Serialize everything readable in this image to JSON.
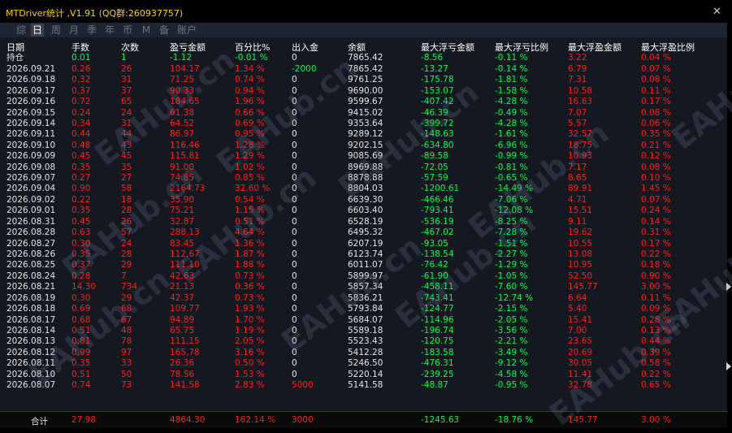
{
  "window": {
    "title": "MTDriver统计 ,V1.91 (QQ群:260937757)",
    "close_label": "✕"
  },
  "tabs": [
    "综",
    "日",
    "周",
    "月",
    "季",
    "年",
    "币",
    "M",
    "备",
    "账户"
  ],
  "active_tab": 1,
  "columns": [
    "日期",
    "手数",
    "次数",
    "盈亏金额",
    "百分比%",
    "出入金",
    "余额",
    "最大浮亏金额",
    "最大浮亏比例",
    "最大浮盈金额",
    "最大浮盈比例"
  ],
  "hold_row": [
    "持仓",
    "0.01",
    "1",
    "-1.12",
    "-0.01 %",
    "0",
    "7865.42",
    "-8.56",
    "-0.11 %",
    "3.22",
    "0.04 %"
  ],
  "rows": [
    [
      "2026.09.21",
      "0.26",
      "26",
      "104.17",
      "1.34 %",
      "-2000",
      "7865.42",
      "-13.27",
      "-0.14 %",
      "6.79",
      "0.07 %"
    ],
    [
      "2026.09.18",
      "0.32",
      "31",
      "71.25",
      "0.74 %",
      "0",
      "9761.25",
      "-175.78",
      "-1.81 %",
      "7.31",
      "0.08 %"
    ],
    [
      "2026.09.17",
      "0.37",
      "37",
      "90.33",
      "0.94 %",
      "0",
      "9690.00",
      "-153.07",
      "-1.58 %",
      "10.58",
      "0.11 %"
    ],
    [
      "2026.09.16",
      "0.72",
      "65",
      "184.65",
      "1.96 %",
      "0",
      "9599.67",
      "-407.42",
      "-4.28 %",
      "16.63",
      "0.17 %"
    ],
    [
      "2026.09.15",
      "0.24",
      "24",
      "61.38",
      "0.66 %",
      "0",
      "9415.02",
      "-46.39",
      "-0.49 %",
      "7.07",
      "0.08 %"
    ],
    [
      "2026.09.14",
      "0.34",
      "31",
      "64.52",
      "0.69 %",
      "0",
      "9353.64",
      "-399.72",
      "-4.28 %",
      "5.57",
      "0.06 %"
    ],
    [
      "2026.09.11",
      "0.44",
      "44",
      "86.97",
      "0.95 %",
      "0",
      "9289.12",
      "-148.63",
      "-1.61 %",
      "32.57",
      "0.35 %"
    ],
    [
      "2026.09.10",
      "0.48",
      "43",
      "116.46",
      "1.28 %",
      "0",
      "9202.15",
      "-634.80",
      "-6.96 %",
      "18.75",
      "0.21 %"
    ],
    [
      "2026.09.09",
      "0.45",
      "45",
      "115.81",
      "1.29 %",
      "0",
      "9085.69",
      "-89.58",
      "-0.99 %",
      "10.93",
      "0.12 %"
    ],
    [
      "2026.09.08",
      "0.35",
      "35",
      "91.00",
      "1.02 %",
      "0",
      "8969.88",
      "-72.05",
      "-0.81 %",
      "7.17",
      "0.08 %"
    ],
    [
      "2026.09.07",
      "0.27",
      "27",
      "74.85",
      "0.85 %",
      "0",
      "8878.88",
      "-57.59",
      "-0.65 %",
      "8.65",
      "0.10 %"
    ],
    [
      "2026.09.04",
      "0.90",
      "58",
      "2164.73",
      "32.60 %",
      "0",
      "8804.03",
      "-1200.61",
      "-14.49 %",
      "89.91",
      "1.45 %"
    ],
    [
      "2026.09.02",
      "0.22",
      "18",
      "35.90",
      "0.54 %",
      "0",
      "6639.30",
      "-466.46",
      "-7.06 %",
      "4.71",
      "0.07 %"
    ],
    [
      "2026.09.01",
      "0.35",
      "28",
      "75.21",
      "1.15 %",
      "0",
      "6603.40",
      "-793.41",
      "-12.08 %",
      "15.51",
      "0.24 %"
    ],
    [
      "2026.08.31",
      "0.45",
      "26",
      "32.87",
      "0.51 %",
      "0",
      "6528.19",
      "-536.19",
      "-8.25 %",
      "9.11",
      "0.14 %"
    ],
    [
      "2026.08.28",
      "0.63",
      "57",
      "288.13",
      "4.64 %",
      "0",
      "6495.32",
      "-467.02",
      "-7.28 %",
      "19.62",
      "0.31 %"
    ],
    [
      "2026.08.27",
      "0.30",
      "24",
      "83.45",
      "1.36 %",
      "0",
      "6207.19",
      "-93.05",
      "-1.51 %",
      "10.55",
      "0.17 %"
    ],
    [
      "2026.08.26",
      "0.35",
      "28",
      "112.67",
      "1.87 %",
      "0",
      "6123.74",
      "-138.54",
      "-2.27 %",
      "13.08",
      "0.22 %"
    ],
    [
      "2026.08.25",
      "0.37",
      "29",
      "111.10",
      "1.88 %",
      "0",
      "6011.07",
      "-76.42",
      "-1.29 %",
      "10.95",
      "0.18 %"
    ],
    [
      "2026.08.24",
      "0.28",
      "7",
      "42.63",
      "0.73 %",
      "0",
      "5899.97",
      "-61.90",
      "-1.05 %",
      "52.50",
      "0.90 %"
    ],
    [
      "2026.08.21",
      "14.30",
      "734",
      "21.13",
      "0.36 %",
      "0",
      "5857.34",
      "-458.11",
      "-7.60 %",
      "145.77",
      "3.00 %"
    ],
    [
      "2026.08.19",
      "0.30",
      "29",
      "42.37",
      "0.73 %",
      "0",
      "5836.21",
      "-743.41",
      "-12.74 %",
      "6.64",
      "0.11 %"
    ],
    [
      "2026.08.18",
      "0.69",
      "68",
      "109.77",
      "1.93 %",
      "0",
      "5793.84",
      "-124.77",
      "-2.15 %",
      "5.40",
      "0.09 %"
    ],
    [
      "2026.08.17",
      "0.68",
      "67",
      "94.89",
      "1.70 %",
      "0",
      "5684.07",
      "-114.96",
      "-2.05 %",
      "15.41",
      "0.28 %"
    ],
    [
      "2026.08.14",
      "0.51",
      "48",
      "65.75",
      "1.19 %",
      "0",
      "5589.18",
      "-196.74",
      "-3.56 %",
      "7.00",
      "0.13 %"
    ],
    [
      "2026.08.13",
      "0.81",
      "78",
      "111.15",
      "2.05 %",
      "0",
      "5523.43",
      "-120.75",
      "-2.21 %",
      "23.65",
      "0.44 %"
    ],
    [
      "2026.08.12",
      "0.99",
      "97",
      "165.78",
      "3.16 %",
      "0",
      "5412.28",
      "-183.58",
      "-3.49 %",
      "20.69",
      "0.39 %"
    ],
    [
      "2026.08.11",
      "0.35",
      "33",
      "26.36",
      "0.50 %",
      "0",
      "5246.50",
      "-476.31",
      "-9.12 %",
      "30.05",
      "0.58 %"
    ],
    [
      "2026.08.10",
      "0.51",
      "50",
      "78.56",
      "1.53 %",
      "0",
      "5220.14",
      "-239.25",
      "-4.58 %",
      "11.41",
      "0.22 %"
    ],
    [
      "2026.08.07",
      "0.74",
      "73",
      "141.58",
      "2.83 %",
      "5000",
      "5141.58",
      "-48.87",
      "-0.95 %",
      "32.78",
      "0.65 %"
    ]
  ],
  "totals": [
    "合计",
    "27.98",
    "",
    "4864.30",
    "162.14 %",
    "3000",
    "",
    "-1245.63",
    "-18.76 %",
    "145.77",
    "3.00 %"
  ],
  "watermark": "EAHub.cn",
  "colors": {
    "title": "#ffd400",
    "positive_red": "#ff1e1e",
    "negative_green": "#00ff4e",
    "text_white": "#e4e4e4",
    "grid_bg": "#141820",
    "selected_row_bg": "#252c3a"
  }
}
